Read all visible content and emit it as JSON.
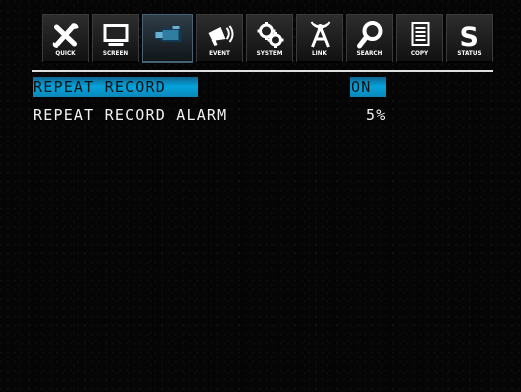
{
  "toolbar": {
    "items": [
      {
        "label": "QUICK",
        "icon": "tools-icon",
        "active": false
      },
      {
        "label": "SCREEN",
        "icon": "monitor-icon",
        "active": false
      },
      {
        "label": "",
        "icon": "camera-icon",
        "active": true
      },
      {
        "label": "EVENT",
        "icon": "megaphone-icon",
        "active": false
      },
      {
        "label": "SYSTEM",
        "icon": "gears-icon",
        "active": false
      },
      {
        "label": "LINK",
        "icon": "antenna-icon",
        "active": false
      },
      {
        "label": "SEARCH",
        "icon": "magnifier-icon",
        "active": false
      },
      {
        "label": "COPY",
        "icon": "document-copy-icon",
        "active": false
      },
      {
        "label": "STATUS",
        "icon": "status-s-icon",
        "active": false
      }
    ]
  },
  "settings": {
    "repeat_record_label": "REPEAT RECORD",
    "repeat_record_value": "ON",
    "repeat_record_alarm_label": "REPEAT RECORD ALARM",
    "repeat_record_alarm_value": "5%"
  },
  "colors": {
    "selection": "#03a3dc",
    "background": "#050505",
    "text": "#f2f2f2"
  }
}
